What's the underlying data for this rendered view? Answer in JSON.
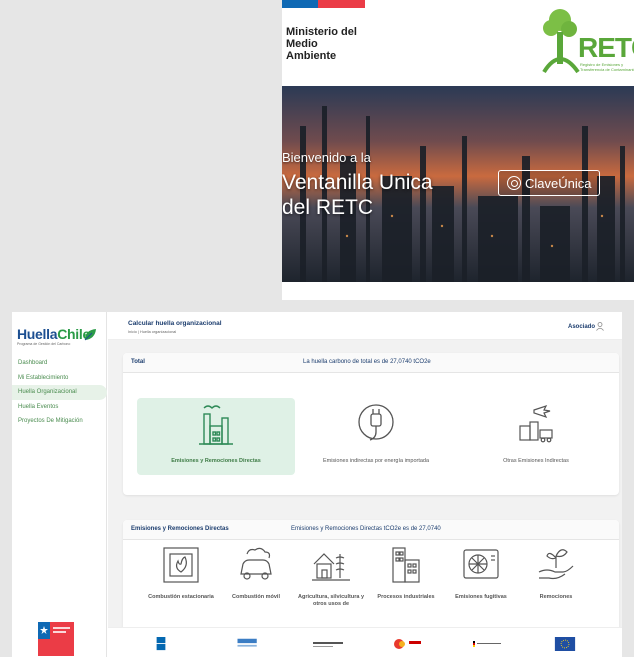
{
  "retc": {
    "ministry": "Ministerio del\nMedio\nAmbiente",
    "logo_word": "RETC",
    "logo_sub": "Registro de Emisiones y Transferencia de Contaminantes",
    "welcome": "Bienvenido a la",
    "title": "Ventanilla Unica del RETC",
    "clave_button": "ClaveÚnica"
  },
  "huella": {
    "brand_a": "Huella",
    "brand_b": "Chile",
    "brand_sub": "Programa de Gestión del Carbono",
    "sidebar": [
      {
        "label": "Dashboard",
        "active": false
      },
      {
        "label": "Mi Establecimiento",
        "active": false
      },
      {
        "label": "Huella Organizacional",
        "active": true
      },
      {
        "label": "Huella Eventos",
        "active": false
      },
      {
        "label": "Proyectos De Mitigación",
        "active": false
      }
    ],
    "page_title": "Calcular huella organizacional",
    "breadcrumb": "Inicio  |  Huella organizacional",
    "user": "Asociado",
    "total": {
      "heading": "Total",
      "summary": "La huella carbono de total es de 27,0740 tCO2e",
      "options": [
        {
          "label": "Emisiones y Remociones Directas",
          "icon": "factory-icon",
          "selected": true
        },
        {
          "label": "Emisiones indirectas por energía importada",
          "icon": "plug-icon",
          "selected": false
        },
        {
          "label": "Otras Emisiones Indirectas",
          "icon": "logistics-icon",
          "selected": false
        }
      ]
    },
    "direct": {
      "heading": "Emisiones y Remociones Directas",
      "summary": "Emisiones y Remociones Directas tCO2e es de 27,0740",
      "sources": [
        {
          "label": "Combustión estacionaria",
          "icon": "furnace-icon"
        },
        {
          "label": "Combustión móvil",
          "icon": "car-icon"
        },
        {
          "label": "Agricultura, silvicultura y otros usos de",
          "icon": "farm-icon"
        },
        {
          "label": "Procesos industriales",
          "icon": "industry-icon"
        },
        {
          "label": "Emisiones fugitivas",
          "icon": "ac-unit-icon"
        },
        {
          "label": "Remociones",
          "icon": "plant-hand-icon"
        }
      ]
    },
    "partners": [
      "UNDP",
      "NDC Partnership",
      "partner",
      "aecid",
      "partner-de",
      "EU"
    ],
    "colors": {
      "accent": "#2a9b47",
      "navy": "#1c3d6e",
      "selected_bg": "#dff1e6"
    }
  }
}
